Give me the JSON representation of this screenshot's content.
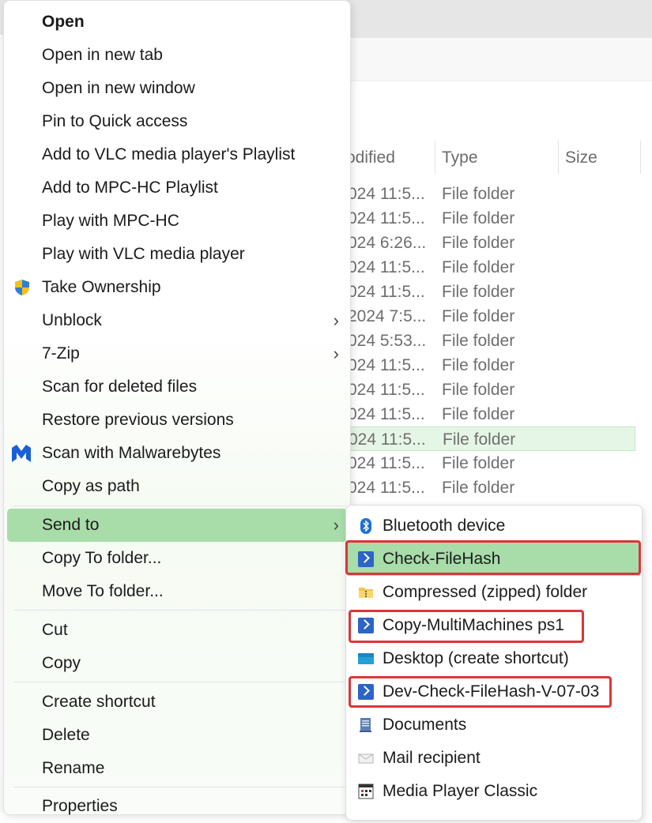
{
  "explorer": {
    "columns": {
      "modified": "odified",
      "type": "Type",
      "size": "Size"
    },
    "rows": [
      {
        "modified": "024 11:5...",
        "type": "File folder"
      },
      {
        "modified": "024 11:5...",
        "type": "File folder"
      },
      {
        "modified": "024 6:26...",
        "type": "File folder"
      },
      {
        "modified": "024 11:5...",
        "type": "File folder"
      },
      {
        "modified": "024 11:5...",
        "type": "File folder"
      },
      {
        "modified": "2024 7:5...",
        "type": "File folder"
      },
      {
        "modified": "024 5:53...",
        "type": "File folder"
      },
      {
        "modified": "024 11:5...",
        "type": "File folder"
      },
      {
        "modified": "024 11:5...",
        "type": "File folder"
      },
      {
        "modified": "024 11:5...",
        "type": "File folder"
      },
      {
        "modified": "024 11:5...",
        "type": "File folder"
      },
      {
        "modified": "024 11:5...",
        "type": "File folder"
      },
      {
        "modified": "024 11:5...",
        "type": "File folder"
      }
    ]
  },
  "context_menu": {
    "items": [
      {
        "label": "Open"
      },
      {
        "label": "Open in new tab"
      },
      {
        "label": "Open in new window"
      },
      {
        "label": "Pin to Quick access"
      },
      {
        "label": "Add to VLC media player's Playlist"
      },
      {
        "label": "Add to MPC-HC Playlist"
      },
      {
        "label": "Play with MPC-HC"
      },
      {
        "label": "Play with VLC media player"
      },
      {
        "label": "Take Ownership",
        "icon": "uac-shield-icon"
      },
      {
        "label": "Unblock"
      },
      {
        "label": "7-Zip"
      },
      {
        "label": "Scan for deleted files"
      },
      {
        "label": "Restore previous versions"
      },
      {
        "label": "Scan with Malwarebytes",
        "icon": "malwarebytes-icon"
      },
      {
        "label": "Copy as path"
      },
      {
        "label": "Send to"
      },
      {
        "label": "Copy To folder..."
      },
      {
        "label": "Move To folder..."
      },
      {
        "label": "Cut"
      },
      {
        "label": "Copy"
      },
      {
        "label": "Create shortcut"
      },
      {
        "label": "Delete"
      },
      {
        "label": "Rename"
      },
      {
        "label": "Properties"
      }
    ],
    "submenu_arrow": "›"
  },
  "send_to": {
    "items": [
      {
        "label": "Bluetooth device",
        "icon": "bluetooth-icon"
      },
      {
        "label": "Check-FileHash",
        "icon": "powershell-icon"
      },
      {
        "label": "Compressed (zipped) folder",
        "icon": "zip-folder-icon"
      },
      {
        "label": "Copy-MultiMachines ps1",
        "icon": "powershell-icon"
      },
      {
        "label": "Desktop (create shortcut)",
        "icon": "desktop-icon"
      },
      {
        "label": "Dev-Check-FileHash-V-07-03",
        "icon": "powershell-icon"
      },
      {
        "label": "Documents",
        "icon": "documents-icon"
      },
      {
        "label": "Mail recipient",
        "icon": "mail-icon"
      },
      {
        "label": "Media Player Classic",
        "icon": "media-player-classic-icon"
      }
    ]
  },
  "colors": {
    "hover_green": "#a8dca9",
    "selection_green": "#e6f6e6",
    "annotation_red": "#d9363b",
    "powershell_blue": "#2c64c8"
  }
}
